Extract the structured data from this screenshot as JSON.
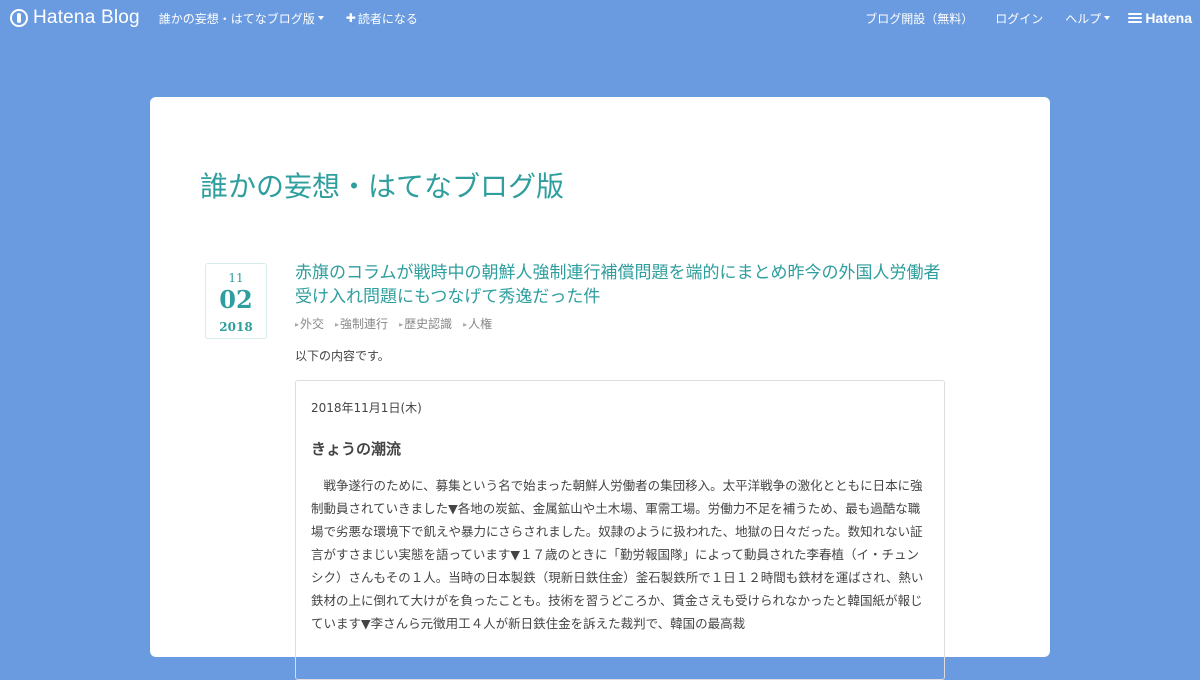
{
  "header": {
    "logo_text": "Hatena Blog",
    "blog_name": "誰かの妄想・はてなブログ版",
    "subscribe": "読者になる",
    "start_blog": "ブログ開設（無料）",
    "login": "ログイン",
    "help": "ヘルプ",
    "hatena_logo": "Hatena"
  },
  "blog": {
    "title": "誰かの妄想・はてなブログ版"
  },
  "entry": {
    "date": {
      "month": "11",
      "day": "02",
      "year": "2018"
    },
    "title": "赤旗のコラムが戦時中の朝鮮人強制連行補償問題を端的にまとめ昨今の外国人労働者受け入れ問題にもつなげて秀逸だった件",
    "categories": [
      "外交",
      "強制連行",
      "歴史認識",
      "人権"
    ],
    "intro": "以下の内容です。",
    "quote": {
      "date": "2018年11月1日(木)",
      "heading": "きょうの潮流",
      "body": "戦争遂行のために、募集という名で始まった朝鮮人労働者の集団移入。太平洋戦争の激化とともに日本に強制動員されていきました▼各地の炭鉱、金属鉱山や土木場、軍需工場。労働力不足を補うため、最も過酷な職場で劣悪な環境下で飢えや暴力にさらされました。奴隷のように扱われた、地獄の日々だった。数知れない証言がすさまじい実態を語っています▼１７歳のときに「勤労報国隊」によって動員された李春植（イ・チュンシク）さんもその１人。当時の日本製鉄（現新日鉄住金）釜石製鉄所で１日１２時間も鉄材を運ばされ、熱い鉄材の上に倒れて大けがを負ったことも。技術を習うどころか、賃金さえも受けられなかったと韓国紙が報じています▼李さんら元徴用工４人が新日鉄住金を訴えた裁判で、韓国の最高裁"
    }
  }
}
